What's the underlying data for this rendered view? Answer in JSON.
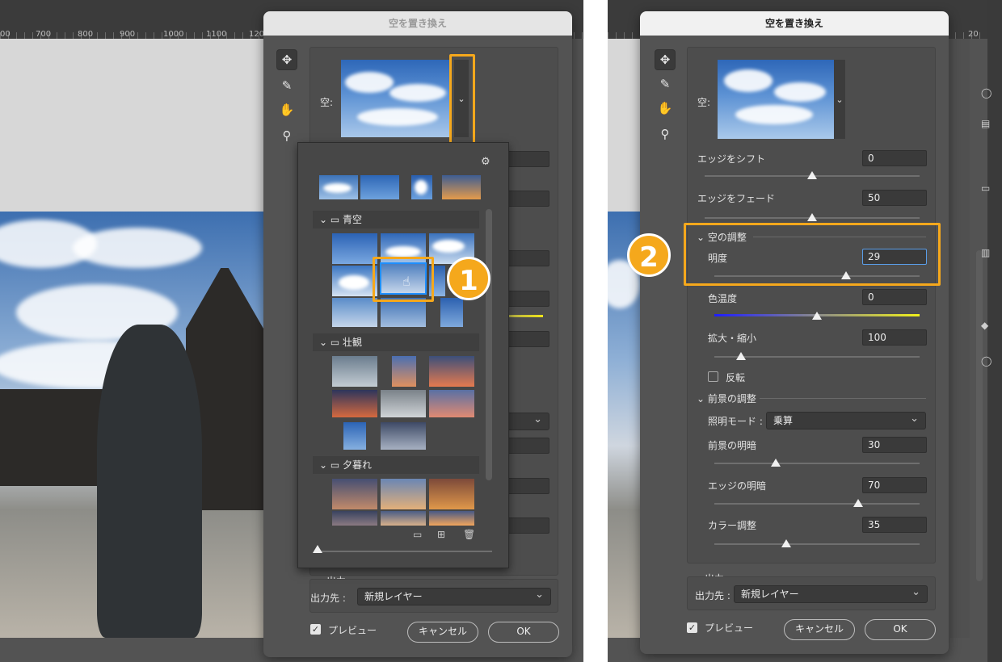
{
  "left": {
    "ruler_labels": [
      "00",
      "700",
      "800",
      "900",
      "1000",
      "1100",
      "120"
    ],
    "dialog_title": "空を置き換え",
    "sky_label": "空:",
    "popup": {
      "categories": [
        "青空",
        "壮観",
        "夕暮れ"
      ]
    },
    "badge": "1",
    "output": {
      "section": "出力",
      "target_label": "出力先 :",
      "target_value": "新規レイヤー"
    },
    "preview_label": "プレビュー",
    "cancel_label": "キャンセル",
    "ok_label": "OK"
  },
  "right": {
    "ruler_label": "20",
    "dialog_title": "空を置き換え",
    "sky_label": "空:",
    "badge": "2",
    "edge_shift": {
      "label": "エッジをシフト",
      "value": "0",
      "level": 0.5
    },
    "edge_fade": {
      "label": "エッジをフェード",
      "value": "50",
      "level": 0.5
    },
    "sky_adjust_section": "空の調整",
    "brightness": {
      "label": "明度",
      "value": "29",
      "level": 0.64
    },
    "temperature": {
      "label": "色温度",
      "value": "0",
      "level": 0.5
    },
    "scale": {
      "label": "拡大・縮小",
      "value": "100",
      "level": 0.13
    },
    "flip_label": "反転",
    "foreground_section": "前景の調整",
    "lighting_mode": {
      "label": "照明モード :",
      "value": "乗算"
    },
    "foreground_lighting": {
      "label": "前景の明暗",
      "value": "30",
      "level": 0.3
    },
    "edge_lighting": {
      "label": "エッジの明暗",
      "value": "70",
      "level": 0.7
    },
    "color_adjust": {
      "label": "カラー調整",
      "value": "35",
      "level": 0.35
    },
    "output": {
      "section": "出力",
      "target_label": "出力先 :",
      "target_value": "新規レイヤー"
    },
    "preview_label": "プレビュー",
    "cancel_label": "キャンセル",
    "ok_label": "OK"
  },
  "colors": {
    "highlight": "#f5a81c",
    "panel_bg": "#535353",
    "field_bg": "#3a3a3a"
  },
  "icons": [
    "move-icon",
    "sky-brush-icon",
    "hand-icon",
    "zoom-icon",
    "gear-icon",
    "folder-icon",
    "chevron-down-icon",
    "new-folder-icon",
    "add-icon",
    "trash-icon",
    "hand-cursor-icon"
  ]
}
